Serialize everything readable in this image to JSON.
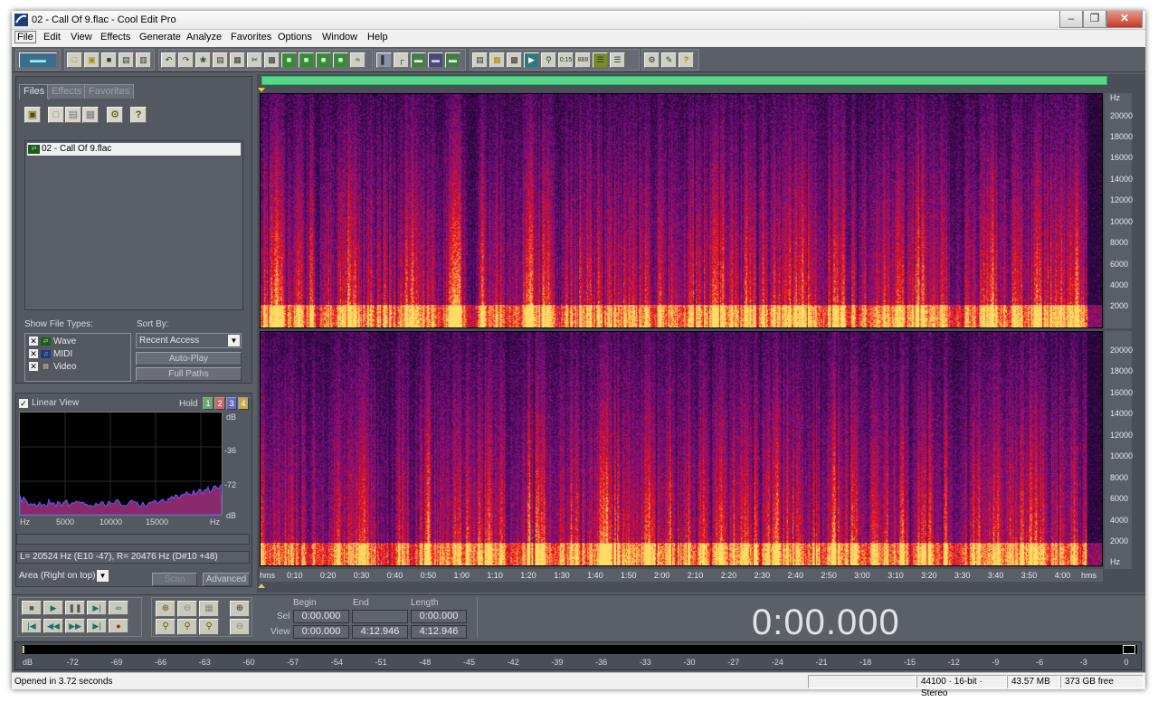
{
  "window": {
    "title": "02 - Call Of 9.flac - Cool Edit Pro",
    "controls": [
      "minimize",
      "maximize",
      "close"
    ]
  },
  "menu": [
    "File",
    "Edit",
    "View",
    "Effects",
    "Generate",
    "Analyze",
    "Favorites",
    "Options",
    "Window",
    "Help"
  ],
  "organizer": {
    "tabs": [
      "Files",
      "Effects",
      "Favorites"
    ],
    "active_tab": "Files",
    "files": [
      "02 - Call Of 9.flac"
    ],
    "show_file_types_label": "Show File Types:",
    "file_types": [
      {
        "label": "Wave",
        "checked": true
      },
      {
        "label": "MIDI",
        "checked": true
      },
      {
        "label": "Video",
        "checked": true
      }
    ],
    "sort_by_label": "Sort By:",
    "sort_by_value": "Recent Access",
    "auto_play_label": "Auto-Play",
    "full_paths_label": "Full Paths"
  },
  "analysis": {
    "linear_view_label": "Linear View",
    "linear_view_checked": true,
    "hold_label": "Hold",
    "hold_buttons": [
      "1",
      "2",
      "3",
      "4"
    ],
    "db_labels": [
      "dB",
      "-36",
      "-72",
      "dB"
    ],
    "hz_labels": [
      "Hz",
      "5000",
      "10000",
      "15000",
      "Hz"
    ],
    "readout": "L=  20524 Hz (E10 -47), R=  20476 Hz (D#10 +48)",
    "mode_value": "Area (Right on top)",
    "scan_label": "Scan",
    "advanced_label": "Advanced"
  },
  "spectral": {
    "freq_unit": "Hz",
    "freq_labels": [
      "20000",
      "18000",
      "16000",
      "14000",
      "12000",
      "10000",
      "8000",
      "6000",
      "4000",
      "2000"
    ],
    "time_labels": [
      "hms",
      "0:10",
      "0:20",
      "0:30",
      "0:40",
      "0:50",
      "1:00",
      "1:10",
      "1:20",
      "1:30",
      "1:40",
      "1:50",
      "2:00",
      "2:10",
      "2:20",
      "2:30",
      "2:40",
      "2:50",
      "3:00",
      "3:10",
      "3:20",
      "3:30",
      "3:40",
      "3:50",
      "4:00",
      "hms"
    ]
  },
  "transport": {
    "col_begin": "Begin",
    "col_end": "End",
    "col_length": "Length",
    "row_sel": "Sel",
    "row_view": "View",
    "sel_begin": "0:00.000",
    "sel_end": "",
    "sel_length": "0:00.000",
    "view_begin": "0:00.000",
    "view_end": "4:12.946",
    "view_length": "4:12.946",
    "current_time": "0:00.000"
  },
  "level_meter": {
    "labels": [
      "dB",
      "-72",
      "-69",
      "-66",
      "-63",
      "-60",
      "-57",
      "-54",
      "-51",
      "-48",
      "-45",
      "-42",
      "-39",
      "-36",
      "-33",
      "-30",
      "-27",
      "-24",
      "-21",
      "-18",
      "-15",
      "-12",
      "-9",
      "-6",
      "-3",
      "0"
    ]
  },
  "status": {
    "message": "Opened in 3.72 seconds",
    "format": "44100 · 16-bit · Stereo",
    "size": "43.57 MB",
    "free": "373 GB free"
  },
  "colors": {
    "panel": "#545860",
    "nav_bar": "#5ad68a",
    "spectral_low": "#2a0a4a",
    "spectral_mid": "#e0101c",
    "spectral_high": "#ffd060"
  }
}
